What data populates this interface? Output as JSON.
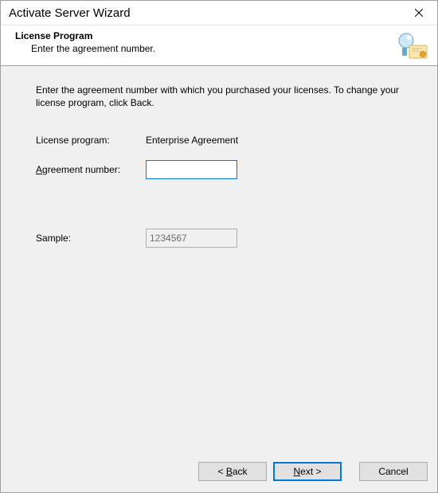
{
  "window": {
    "title": "Activate Server Wizard"
  },
  "header": {
    "title": "License Program",
    "subtitle": "Enter the agreement number."
  },
  "content": {
    "instruction": "Enter the agreement number with which you purchased your licenses. To change your license program, click Back.",
    "license_program_label": "License program:",
    "license_program_value": "Enterprise Agreement",
    "agreement_label_prefix": "A",
    "agreement_label_rest": "greement number:",
    "agreement_value": "",
    "sample_label": "Sample:",
    "sample_value": "1234567"
  },
  "footer": {
    "back_prefix": "< ",
    "back_u": "B",
    "back_rest": "ack",
    "next_u": "N",
    "next_rest": "ext >",
    "cancel": "Cancel"
  }
}
